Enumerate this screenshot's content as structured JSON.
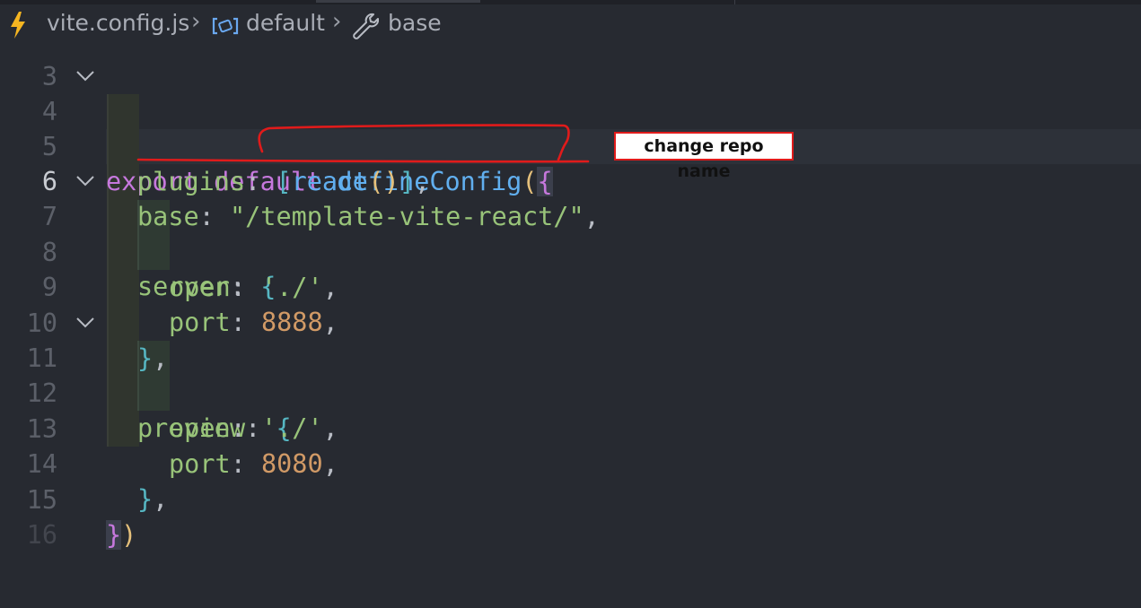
{
  "breadcrumb": {
    "file": "vite.config.js",
    "symbol1": "default",
    "symbol2": "base",
    "icons": [
      "vite-bolt-icon",
      "module-icon",
      "wrench-icon"
    ]
  },
  "lines": [
    {
      "num": "4",
      "fold": true
    },
    {
      "num": "5"
    },
    {
      "num": "6",
      "current": true
    },
    {
      "num": "7",
      "fold": true
    },
    {
      "num": "8"
    },
    {
      "num": "9"
    },
    {
      "num": "10"
    },
    {
      "num": "11",
      "fold": true
    },
    {
      "num": "12"
    },
    {
      "num": "13"
    },
    {
      "num": "14"
    },
    {
      "num": "15"
    },
    {
      "num": "16"
    }
  ],
  "code": {
    "l4_kw1": "export",
    "l4_kw2": "default",
    "l4_fn": "defineConfig",
    "l4_open": "(",
    "l4_brace": "{",
    "l5_prop": "plugins",
    "l5_colon": ": ",
    "l5_arr_open": "[",
    "l5_call": "react",
    "l5_parens": "()",
    "l5_arr_close": "]",
    "l5_comma": ",",
    "l6_prop": "base",
    "l6_colon": ": ",
    "l6_str": "\"/template-vite-react/\"",
    "l6_comma": ",",
    "l7_prop": "server",
    "l7_colon": ": ",
    "l7_brace": "{",
    "l8_prop": "open",
    "l8_colon": ": ",
    "l8_str": "'./'",
    "l8_comma": ",",
    "l9_prop": "port",
    "l9_colon": ": ",
    "l9_num": "8888",
    "l9_comma": ",",
    "l10_brace": "}",
    "l10_comma": ",",
    "l11_prop": "preview",
    "l11_colon": ": ",
    "l11_brace": "{",
    "l12_prop": "open",
    "l12_colon": ": ",
    "l12_str": "'./'",
    "l12_comma": ",",
    "l13_prop": "port",
    "l13_colon": ": ",
    "l13_num": "8080",
    "l13_comma": ",",
    "l14_brace": "}",
    "l14_comma": ",",
    "l15_brace": "}",
    "l15_close": ")"
  },
  "annotation": {
    "label": "change repo name",
    "color": "#e01b1b"
  },
  "colors": {
    "background": "#272a31",
    "keyword": "#c678dd",
    "function": "#61afef",
    "string": "#98c379",
    "number": "#d19a66",
    "bracket": "#56b6c2",
    "line_number": "#5c6069"
  }
}
